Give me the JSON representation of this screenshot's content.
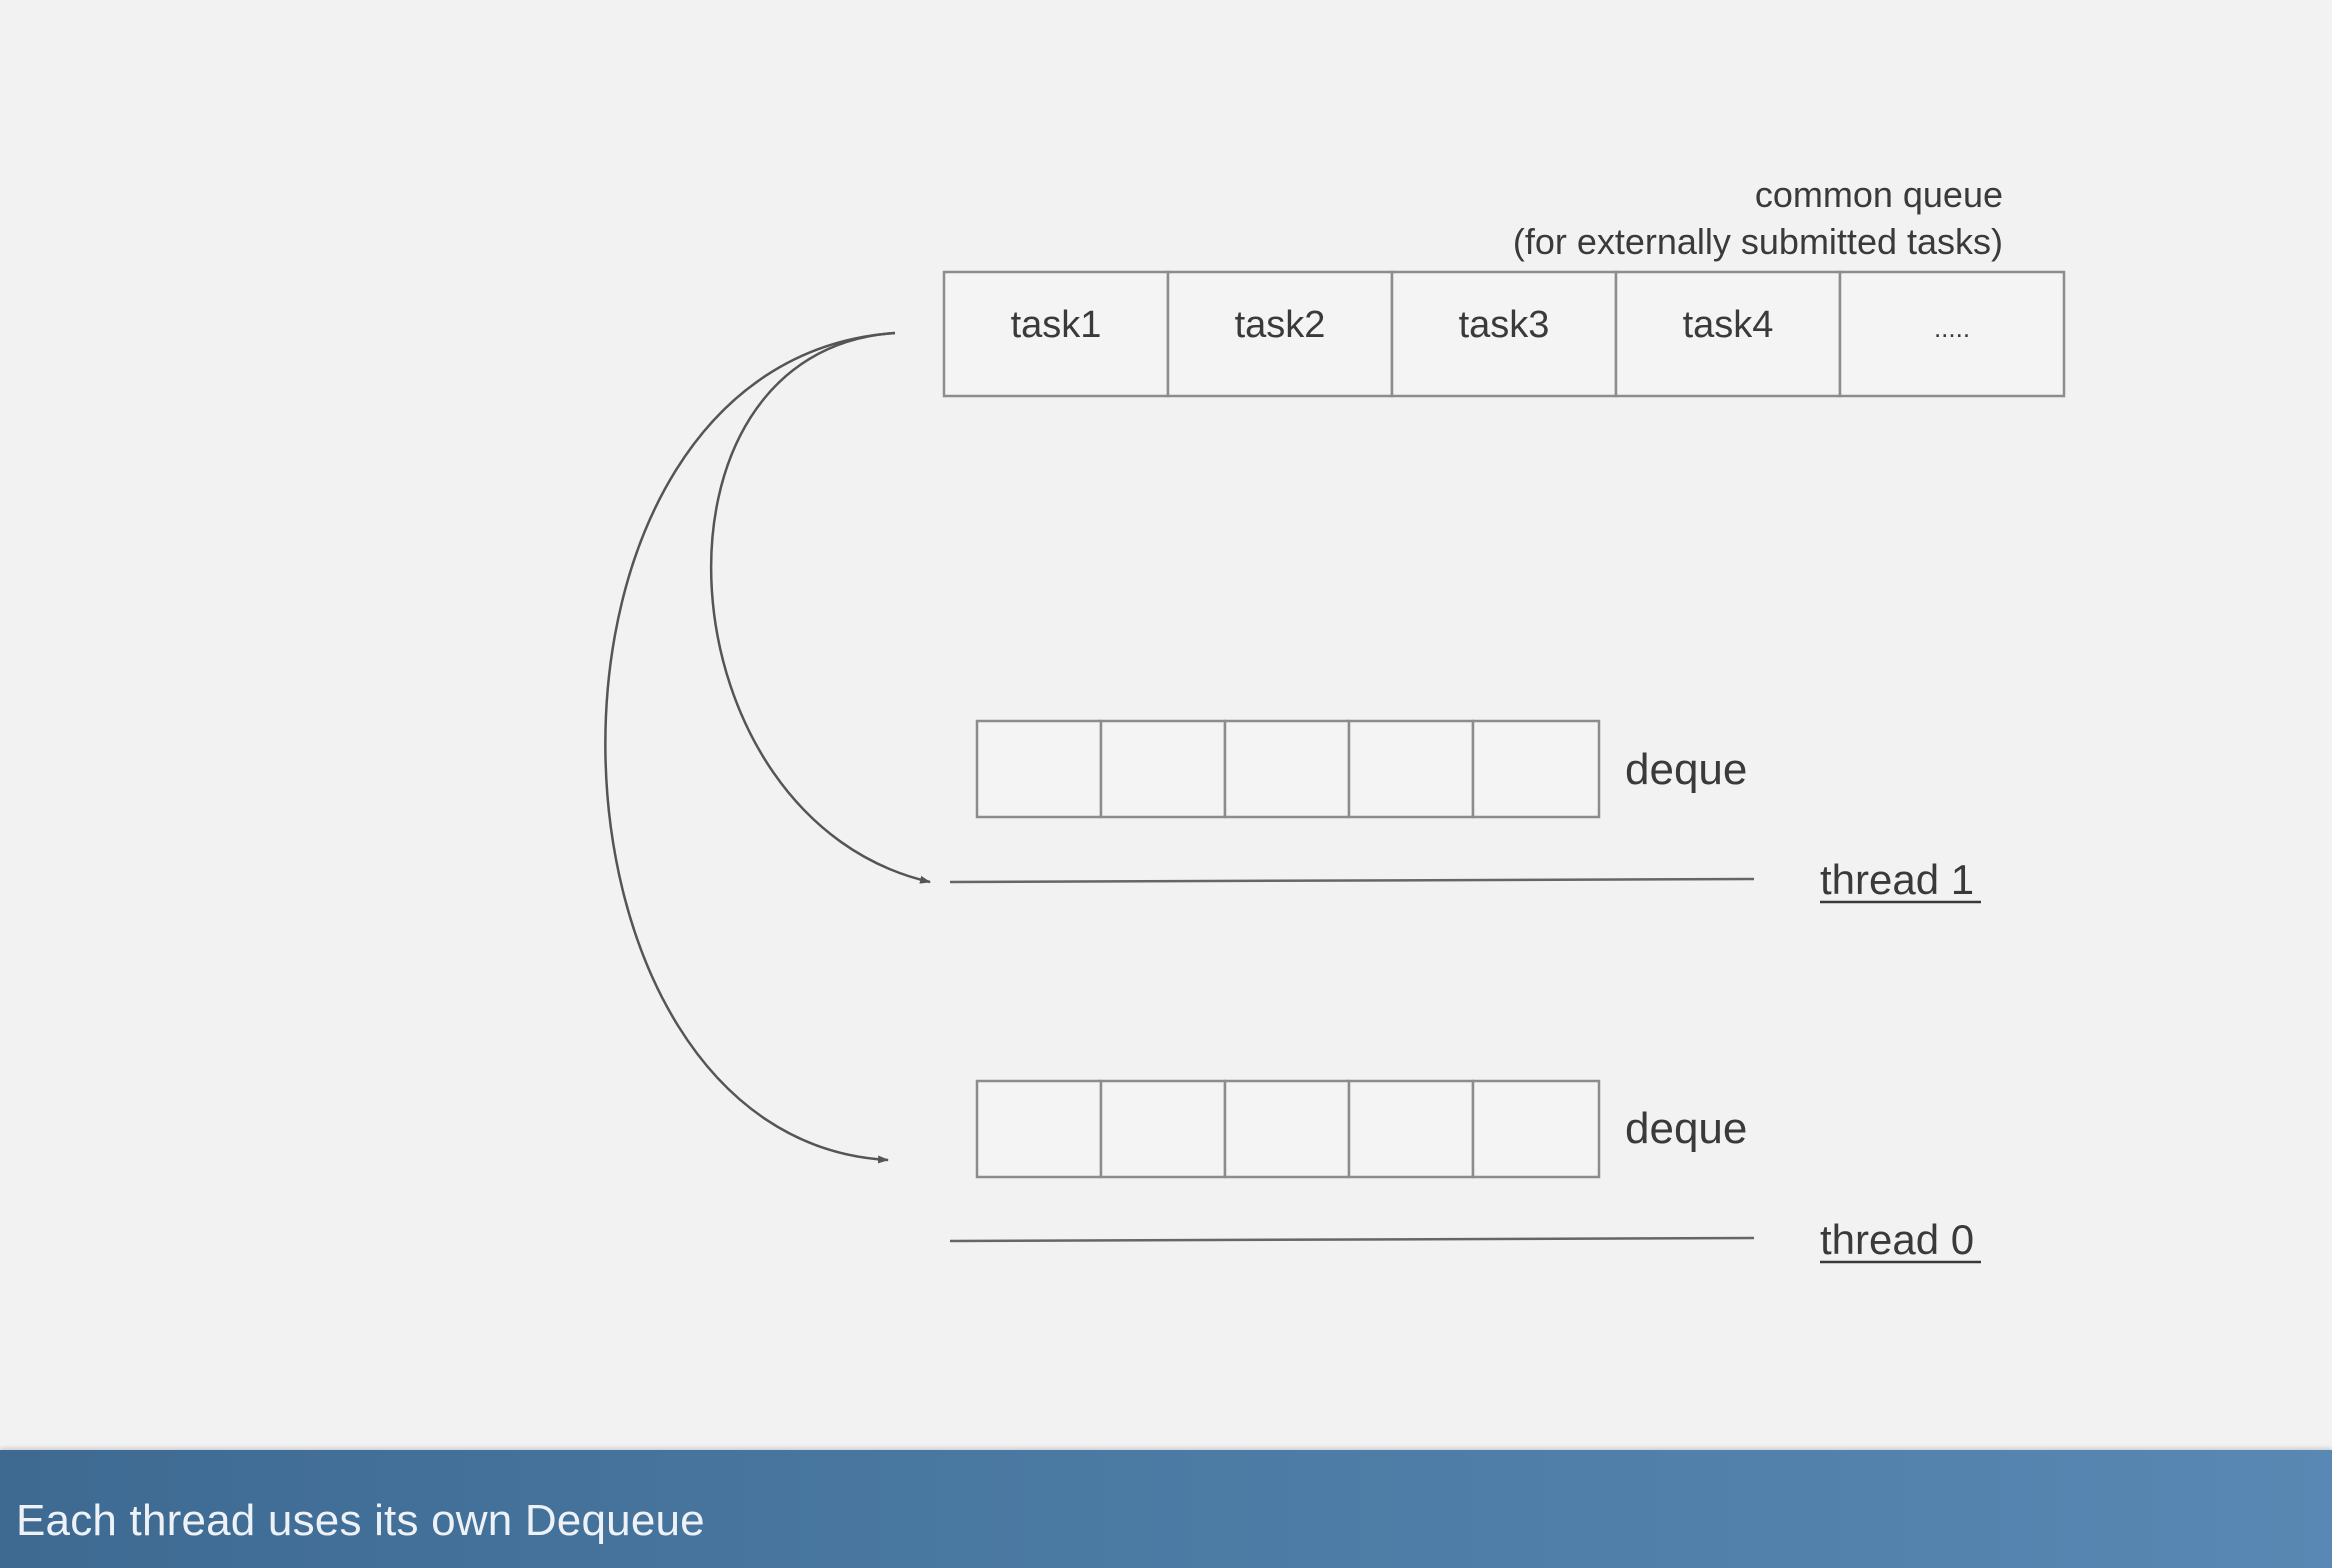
{
  "common_queue": {
    "caption_line1": "common queue",
    "caption_line2": "(for externally submitted tasks)",
    "cells": [
      "task1",
      "task2",
      "task3",
      "task4",
      "....."
    ]
  },
  "deques": [
    {
      "label": "deque",
      "thread": "thread 1"
    },
    {
      "label": "deque",
      "thread": "thread 0"
    }
  ],
  "caption_bar": {
    "text": "Each thread uses its own Dequeue"
  },
  "colors": {
    "background": "#f2f2f2",
    "caption_bar": "#4a79a2",
    "lines": "#666666"
  }
}
